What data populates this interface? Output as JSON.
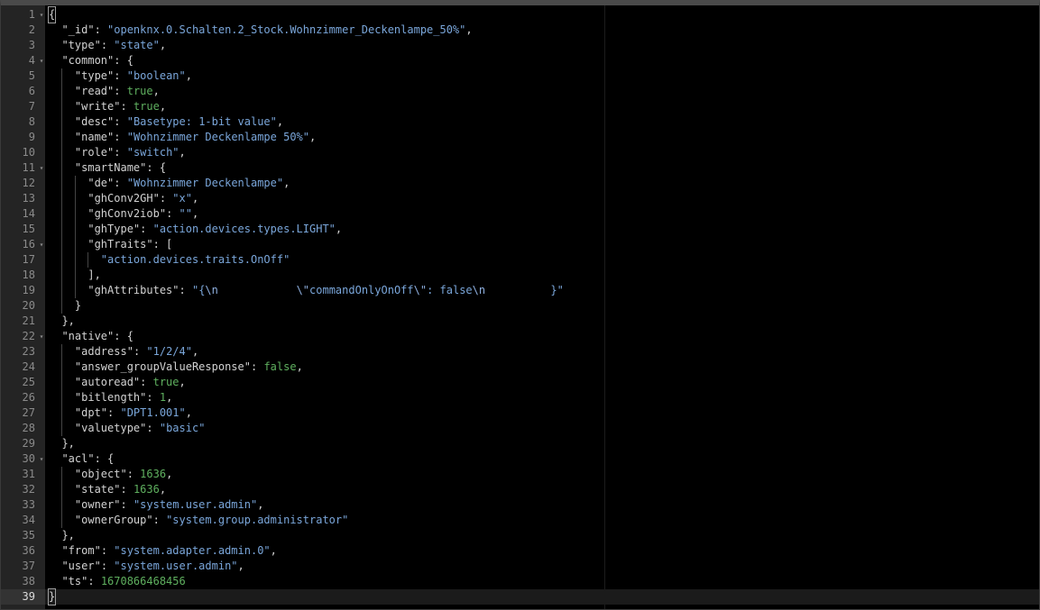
{
  "editor": {
    "lines": [
      {
        "n": "1",
        "fold": true,
        "guides": 0,
        "tokens": [
          [
            "{",
            "punc"
          ]
        ],
        "cursorFirst": true
      },
      {
        "n": "2",
        "fold": false,
        "guides": 0,
        "indent": "  ",
        "tokens": [
          [
            "\"_id\"",
            "key"
          ],
          [
            ": ",
            "punc"
          ],
          [
            "\"openknx.0.Schalten.2_Stock.Wohnzimmer_Deckenlampe_50%\"",
            "str"
          ],
          [
            ",",
            "punc"
          ]
        ]
      },
      {
        "n": "3",
        "fold": false,
        "guides": 0,
        "indent": "  ",
        "tokens": [
          [
            "\"type\"",
            "key"
          ],
          [
            ": ",
            "punc"
          ],
          [
            "\"state\"",
            "str"
          ],
          [
            ",",
            "punc"
          ]
        ]
      },
      {
        "n": "4",
        "fold": true,
        "guides": 0,
        "indent": "  ",
        "tokens": [
          [
            "\"common\"",
            "key"
          ],
          [
            ": {",
            "punc"
          ]
        ]
      },
      {
        "n": "5",
        "fold": false,
        "guides": 1,
        "indent": "    ",
        "tokens": [
          [
            "\"type\"",
            "key"
          ],
          [
            ": ",
            "punc"
          ],
          [
            "\"boolean\"",
            "str"
          ],
          [
            ",",
            "punc"
          ]
        ]
      },
      {
        "n": "6",
        "fold": false,
        "guides": 1,
        "indent": "    ",
        "tokens": [
          [
            "\"read\"",
            "key"
          ],
          [
            ": ",
            "punc"
          ],
          [
            "true",
            "bool"
          ],
          [
            ",",
            "punc"
          ]
        ]
      },
      {
        "n": "7",
        "fold": false,
        "guides": 1,
        "indent": "    ",
        "tokens": [
          [
            "\"write\"",
            "key"
          ],
          [
            ": ",
            "punc"
          ],
          [
            "true",
            "bool"
          ],
          [
            ",",
            "punc"
          ]
        ]
      },
      {
        "n": "8",
        "fold": false,
        "guides": 1,
        "indent": "    ",
        "tokens": [
          [
            "\"desc\"",
            "key"
          ],
          [
            ": ",
            "punc"
          ],
          [
            "\"Basetype: 1-bit value\"",
            "str"
          ],
          [
            ",",
            "punc"
          ]
        ]
      },
      {
        "n": "9",
        "fold": false,
        "guides": 1,
        "indent": "    ",
        "tokens": [
          [
            "\"name\"",
            "key"
          ],
          [
            ": ",
            "punc"
          ],
          [
            "\"Wohnzimmer Deckenlampe 50%\"",
            "str"
          ],
          [
            ",",
            "punc"
          ]
        ]
      },
      {
        "n": "10",
        "fold": false,
        "guides": 1,
        "indent": "    ",
        "tokens": [
          [
            "\"role\"",
            "key"
          ],
          [
            ": ",
            "punc"
          ],
          [
            "\"switch\"",
            "str"
          ],
          [
            ",",
            "punc"
          ]
        ]
      },
      {
        "n": "11",
        "fold": true,
        "guides": 1,
        "indent": "    ",
        "tokens": [
          [
            "\"smartName\"",
            "key"
          ],
          [
            ": {",
            "punc"
          ]
        ]
      },
      {
        "n": "12",
        "fold": false,
        "guides": 2,
        "indent": "      ",
        "tokens": [
          [
            "\"de\"",
            "key"
          ],
          [
            ": ",
            "punc"
          ],
          [
            "\"Wohnzimmer Deckenlampe\"",
            "str"
          ],
          [
            ",",
            "punc"
          ]
        ]
      },
      {
        "n": "13",
        "fold": false,
        "guides": 2,
        "indent": "      ",
        "tokens": [
          [
            "\"ghConv2GH\"",
            "key"
          ],
          [
            ": ",
            "punc"
          ],
          [
            "\"x\"",
            "str"
          ],
          [
            ",",
            "punc"
          ]
        ]
      },
      {
        "n": "14",
        "fold": false,
        "guides": 2,
        "indent": "      ",
        "tokens": [
          [
            "\"ghConv2iob\"",
            "key"
          ],
          [
            ": ",
            "punc"
          ],
          [
            "\"\"",
            "str"
          ],
          [
            ",",
            "punc"
          ]
        ]
      },
      {
        "n": "15",
        "fold": false,
        "guides": 2,
        "indent": "      ",
        "tokens": [
          [
            "\"ghType\"",
            "key"
          ],
          [
            ": ",
            "punc"
          ],
          [
            "\"action.devices.types.LIGHT\"",
            "str"
          ],
          [
            ",",
            "punc"
          ]
        ]
      },
      {
        "n": "16",
        "fold": true,
        "guides": 2,
        "indent": "      ",
        "tokens": [
          [
            "\"ghTraits\"",
            "key"
          ],
          [
            ": [",
            "punc"
          ]
        ]
      },
      {
        "n": "17",
        "fold": false,
        "guides": 3,
        "indent": "        ",
        "tokens": [
          [
            "\"action.devices.traits.OnOff\"",
            "str"
          ]
        ]
      },
      {
        "n": "18",
        "fold": false,
        "guides": 2,
        "indent": "      ",
        "tokens": [
          [
            "],",
            "punc"
          ]
        ]
      },
      {
        "n": "19",
        "fold": false,
        "guides": 2,
        "indent": "      ",
        "tokens": [
          [
            "\"ghAttributes\"",
            "key"
          ],
          [
            ": ",
            "punc"
          ],
          [
            "\"{",
            "str"
          ],
          [
            "\\n",
            "esc"
          ],
          [
            "            ",
            "str"
          ],
          [
            "\\\"",
            "esc"
          ],
          [
            "commandOnlyOnOff",
            "str"
          ],
          [
            "\\\"",
            "esc"
          ],
          [
            ": false",
            "str"
          ],
          [
            "\\n",
            "esc"
          ],
          [
            "          }\"",
            "str"
          ]
        ]
      },
      {
        "n": "20",
        "fold": false,
        "guides": 1,
        "indent": "    ",
        "tokens": [
          [
            "}",
            "punc"
          ]
        ]
      },
      {
        "n": "21",
        "fold": false,
        "guides": 0,
        "indent": "  ",
        "tokens": [
          [
            "},",
            "punc"
          ]
        ]
      },
      {
        "n": "22",
        "fold": true,
        "guides": 0,
        "indent": "  ",
        "tokens": [
          [
            "\"native\"",
            "key"
          ],
          [
            ": {",
            "punc"
          ]
        ]
      },
      {
        "n": "23",
        "fold": false,
        "guides": 1,
        "indent": "    ",
        "tokens": [
          [
            "\"address\"",
            "key"
          ],
          [
            ": ",
            "punc"
          ],
          [
            "\"1/2/4\"",
            "str"
          ],
          [
            ",",
            "punc"
          ]
        ]
      },
      {
        "n": "24",
        "fold": false,
        "guides": 1,
        "indent": "    ",
        "tokens": [
          [
            "\"answer_groupValueResponse\"",
            "key"
          ],
          [
            ": ",
            "punc"
          ],
          [
            "false",
            "bool"
          ],
          [
            ",",
            "punc"
          ]
        ]
      },
      {
        "n": "25",
        "fold": false,
        "guides": 1,
        "indent": "    ",
        "tokens": [
          [
            "\"autoread\"",
            "key"
          ],
          [
            ": ",
            "punc"
          ],
          [
            "true",
            "bool"
          ],
          [
            ",",
            "punc"
          ]
        ]
      },
      {
        "n": "26",
        "fold": false,
        "guides": 1,
        "indent": "    ",
        "tokens": [
          [
            "\"bitlength\"",
            "key"
          ],
          [
            ": ",
            "punc"
          ],
          [
            "1",
            "num"
          ],
          [
            ",",
            "punc"
          ]
        ]
      },
      {
        "n": "27",
        "fold": false,
        "guides": 1,
        "indent": "    ",
        "tokens": [
          [
            "\"dpt\"",
            "key"
          ],
          [
            ": ",
            "punc"
          ],
          [
            "\"DPT1.001\"",
            "str"
          ],
          [
            ",",
            "punc"
          ]
        ]
      },
      {
        "n": "28",
        "fold": false,
        "guides": 1,
        "indent": "    ",
        "tokens": [
          [
            "\"valuetype\"",
            "key"
          ],
          [
            ": ",
            "punc"
          ],
          [
            "\"basic\"",
            "str"
          ]
        ]
      },
      {
        "n": "29",
        "fold": false,
        "guides": 0,
        "indent": "  ",
        "tokens": [
          [
            "},",
            "punc"
          ]
        ]
      },
      {
        "n": "30",
        "fold": true,
        "guides": 0,
        "indent": "  ",
        "tokens": [
          [
            "\"acl\"",
            "key"
          ],
          [
            ": {",
            "punc"
          ]
        ]
      },
      {
        "n": "31",
        "fold": false,
        "guides": 1,
        "indent": "    ",
        "tokens": [
          [
            "\"object\"",
            "key"
          ],
          [
            ": ",
            "punc"
          ],
          [
            "1636",
            "num"
          ],
          [
            ",",
            "punc"
          ]
        ]
      },
      {
        "n": "32",
        "fold": false,
        "guides": 1,
        "indent": "    ",
        "tokens": [
          [
            "\"state\"",
            "key"
          ],
          [
            ": ",
            "punc"
          ],
          [
            "1636",
            "num"
          ],
          [
            ",",
            "punc"
          ]
        ]
      },
      {
        "n": "33",
        "fold": false,
        "guides": 1,
        "indent": "    ",
        "tokens": [
          [
            "\"owner\"",
            "key"
          ],
          [
            ": ",
            "punc"
          ],
          [
            "\"system.user.admin\"",
            "str"
          ],
          [
            ",",
            "punc"
          ]
        ]
      },
      {
        "n": "34",
        "fold": false,
        "guides": 1,
        "indent": "    ",
        "tokens": [
          [
            "\"ownerGroup\"",
            "key"
          ],
          [
            ": ",
            "punc"
          ],
          [
            "\"system.group.administrator\"",
            "str"
          ]
        ]
      },
      {
        "n": "35",
        "fold": false,
        "guides": 0,
        "indent": "  ",
        "tokens": [
          [
            "},",
            "punc"
          ]
        ]
      },
      {
        "n": "36",
        "fold": false,
        "guides": 0,
        "indent": "  ",
        "tokens": [
          [
            "\"from\"",
            "key"
          ],
          [
            ": ",
            "punc"
          ],
          [
            "\"system.adapter.admin.0\"",
            "str"
          ],
          [
            ",",
            "punc"
          ]
        ]
      },
      {
        "n": "37",
        "fold": false,
        "guides": 0,
        "indent": "  ",
        "tokens": [
          [
            "\"user\"",
            "key"
          ],
          [
            ": ",
            "punc"
          ],
          [
            "\"system.user.admin\"",
            "str"
          ],
          [
            ",",
            "punc"
          ]
        ]
      },
      {
        "n": "38",
        "fold": false,
        "guides": 0,
        "indent": "  ",
        "tokens": [
          [
            "\"ts\"",
            "key"
          ],
          [
            ": ",
            "punc"
          ],
          [
            "1670866468456",
            "num"
          ]
        ]
      },
      {
        "n": "39",
        "fold": false,
        "guides": 0,
        "active": true,
        "tokens": [
          [
            "}",
            "punc"
          ]
        ],
        "cursorFirst": true
      }
    ]
  }
}
